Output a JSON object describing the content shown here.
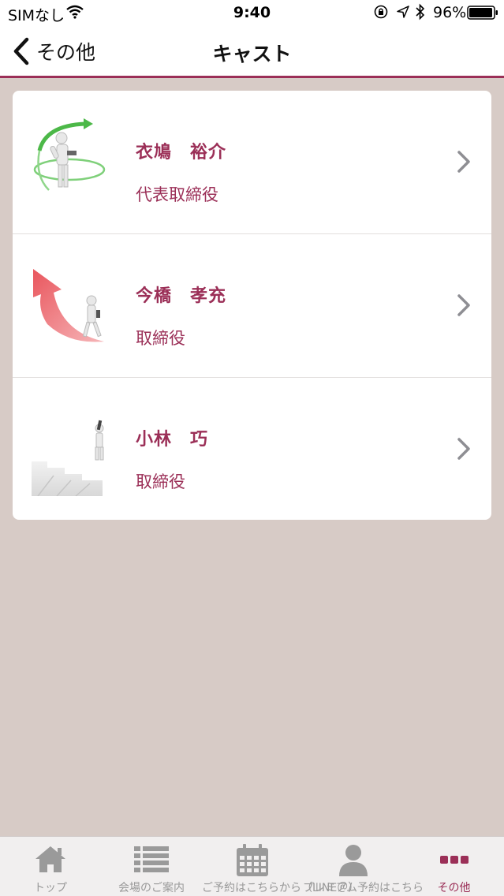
{
  "status_bar": {
    "carrier": "SIMなし",
    "time": "9:40",
    "battery": "96%"
  },
  "nav": {
    "back_label": "その他",
    "title": "キャスト"
  },
  "cast": [
    {
      "name": "衣鳩　裕介",
      "role": "代表取締役",
      "image": "ring-arrow-figure-icon"
    },
    {
      "name": "今橋　孝充",
      "role": "取締役",
      "image": "red-arrow-runner-icon"
    },
    {
      "name": "小林　巧",
      "role": "取締役",
      "image": "stairs-climber-icon"
    }
  ],
  "tabs": [
    {
      "label": "トップ",
      "icon": "home-icon",
      "active": false
    },
    {
      "label": "会場のご案内",
      "icon": "list-icon",
      "active": false
    },
    {
      "label": "ご予約はこちらから（LINE＠）",
      "icon": "calendar-icon",
      "active": false
    },
    {
      "label": "プレミアム予約はこちら",
      "icon": "person-icon",
      "active": false
    },
    {
      "label": "その他",
      "icon": "more-icon",
      "active": true
    }
  ],
  "colors": {
    "accent": "#9b2f57",
    "background": "#d7cbc6",
    "tab_inactive": "#999999"
  }
}
